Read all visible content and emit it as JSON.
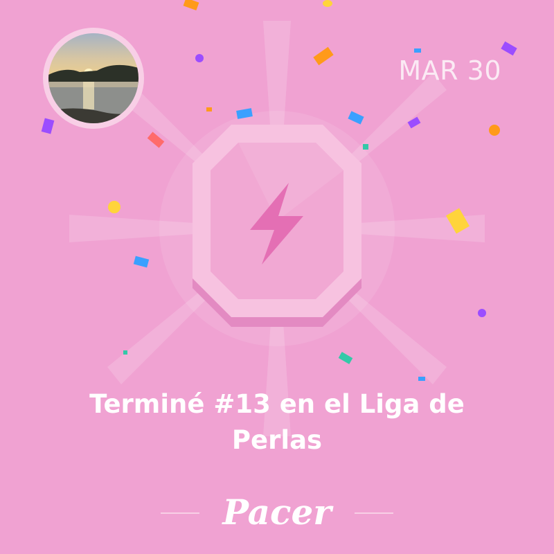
{
  "date": "MAR 30",
  "badge": {
    "icon": "lightning-bolt-icon"
  },
  "headline": {
    "line1": "Terminé #13 en el Liga de",
    "line2": "Perlas"
  },
  "brand": {
    "logo_text": "Pacer"
  },
  "colors": {
    "background": "#f0a2d2",
    "badge_outer": "#f7c2e0",
    "badge_inner": "#f1a8d3",
    "bolt": "#e46fb4",
    "text": "#ffffff"
  },
  "confetti_colors": [
    "#9b4dff",
    "#ff9a1a",
    "#3aa0ff",
    "#ffd43b",
    "#ff6b6b",
    "#33c9a8"
  ]
}
